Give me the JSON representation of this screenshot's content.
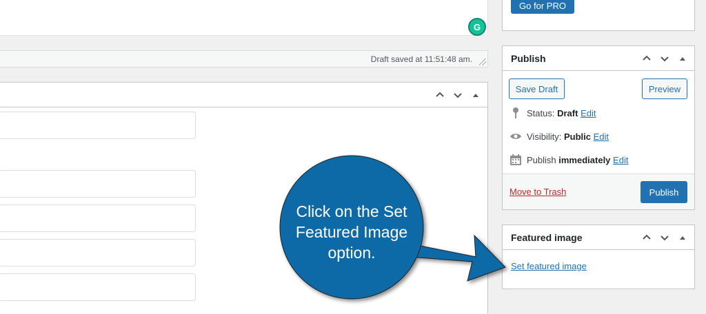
{
  "editor": {
    "draft_status": "Draft saved at 11:51:48 am.",
    "grammarly_letter": "G"
  },
  "sidebar": {
    "pro_button_label": "Go for PRO",
    "publish": {
      "title": "Publish",
      "save_draft_label": "Save Draft",
      "preview_label": "Preview",
      "status_label": "Status:",
      "status_value": "Draft",
      "status_edit": "Edit",
      "visibility_label": "Visibility:",
      "visibility_value": "Public",
      "visibility_edit": "Edit",
      "schedule_label": "Publish",
      "schedule_value": "immediately",
      "schedule_edit": "Edit",
      "trash_label": "Move to Trash",
      "publish_label": "Publish"
    },
    "featured": {
      "title": "Featured image",
      "set_link": "Set featured image"
    }
  },
  "annotation": {
    "line1": "Click on the Set",
    "line2": "Featured Image",
    "line3": "option.",
    "bubble_color": "#0c6aa6"
  },
  "icons": {
    "up": "chevron-up-icon",
    "down": "chevron-down-icon",
    "toggle": "triangle-up-icon",
    "status": "pin-icon",
    "visibility": "eye-icon",
    "schedule": "calendar-icon"
  }
}
